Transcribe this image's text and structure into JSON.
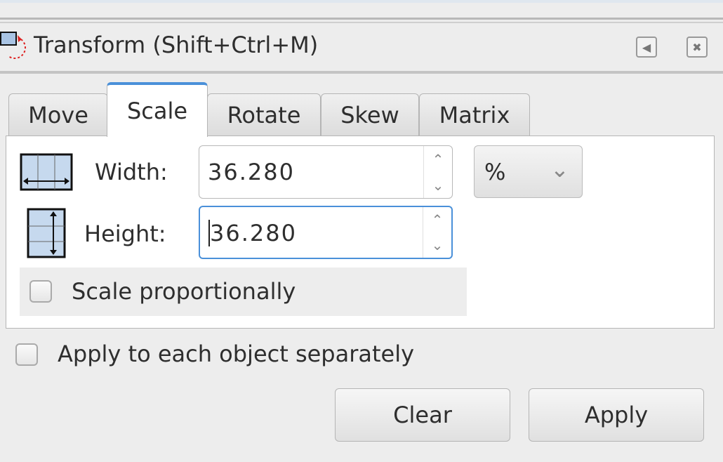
{
  "window": {
    "title": "Transform (Shift+Ctrl+M)",
    "icon": "transform-icon",
    "buttons": [
      "iconify-icon",
      "close-icon"
    ]
  },
  "tabs": [
    {
      "label": "Move"
    },
    {
      "label": "Scale",
      "active": true
    },
    {
      "label": "Rotate"
    },
    {
      "label": "Skew"
    },
    {
      "label": "Matrix"
    }
  ],
  "scale": {
    "width_label": "Width:",
    "width_value": "36.280",
    "height_label": "Height:",
    "height_value": "36.280",
    "unit": "%",
    "proportional_label": "Scale proportionally",
    "proportional_checked": false
  },
  "apply_each_label": "Apply to each object separately",
  "apply_each_checked": false,
  "buttons": {
    "clear": "Clear",
    "apply": "Apply"
  },
  "colors": {
    "accent": "#4a90d9",
    "background": "#ededed"
  }
}
